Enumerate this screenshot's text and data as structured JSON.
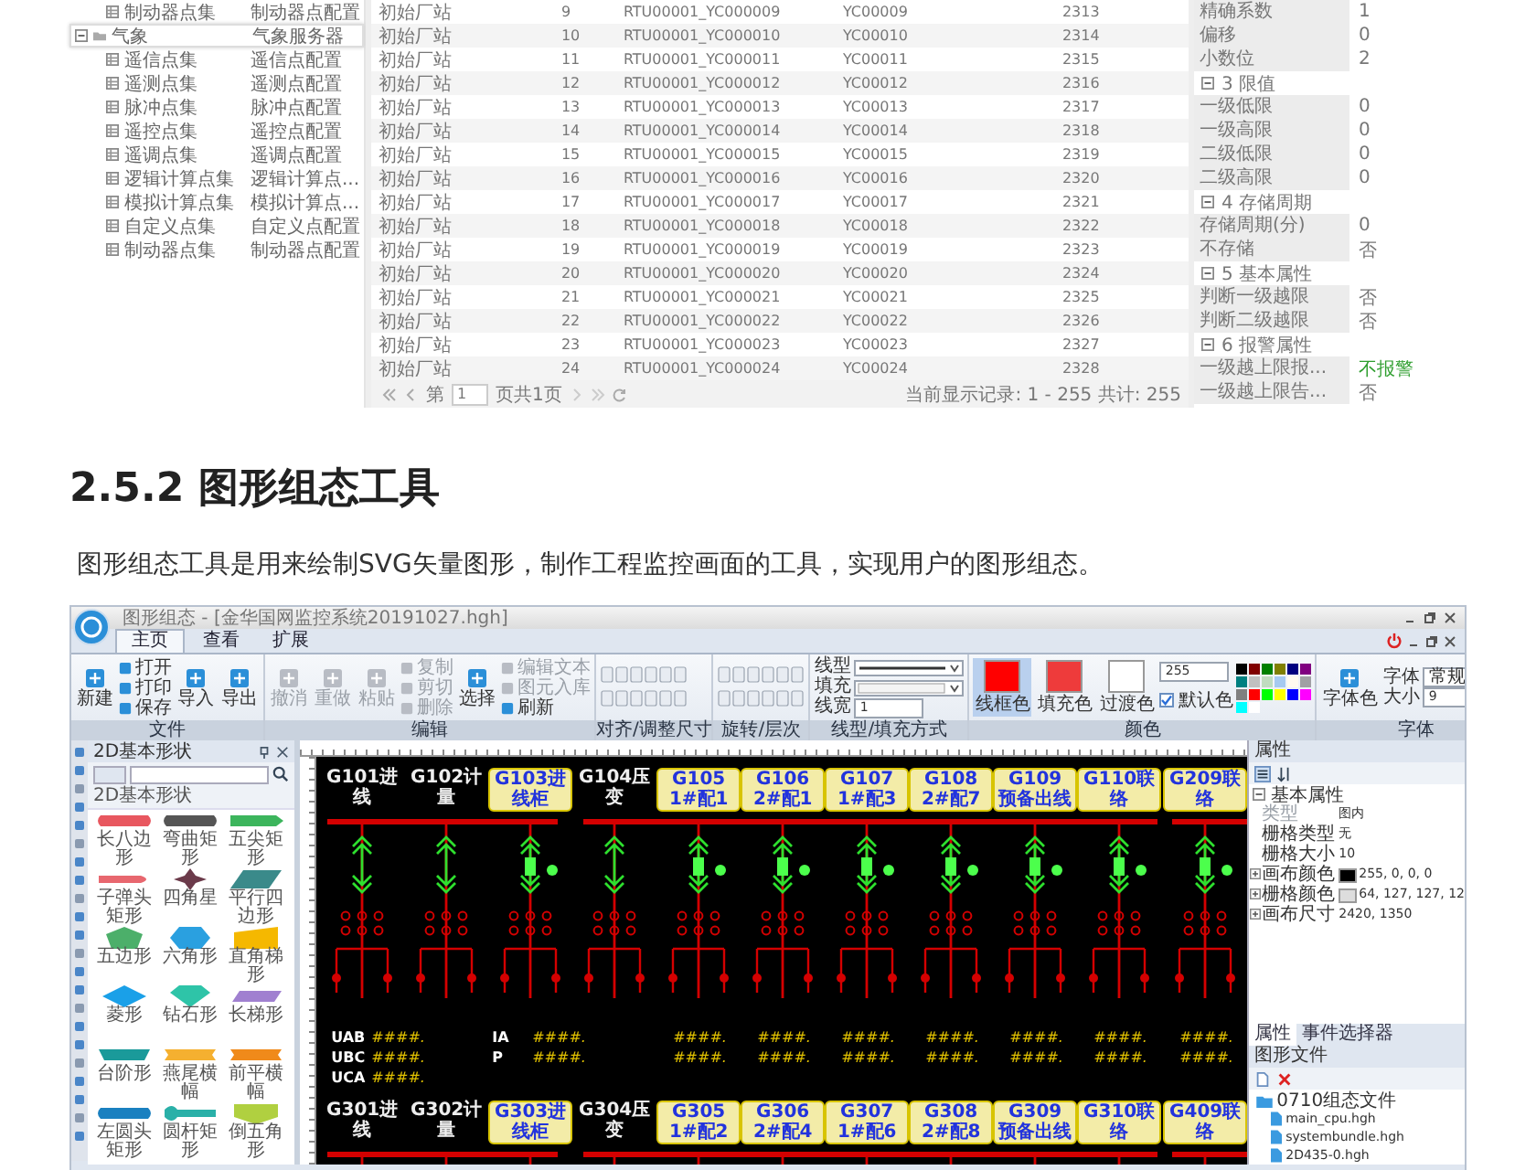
{
  "top_screenshot": {
    "tree": [
      {
        "label": "制动器点集",
        "config": "制动器点配置",
        "kind": "leaf",
        "selected": false
      },
      {
        "label": "气象",
        "config": "气象服务器",
        "kind": "folder",
        "selected": true
      },
      {
        "label": "遥信点集",
        "config": "遥信点配置",
        "kind": "leaf",
        "selected": false
      },
      {
        "label": "遥测点集",
        "config": "遥测点配置",
        "kind": "leaf",
        "selected": false
      },
      {
        "label": "脉冲点集",
        "config": "脉冲点配置",
        "kind": "leaf",
        "selected": false
      },
      {
        "label": "遥控点集",
        "config": "遥控点配置",
        "kind": "leaf",
        "selected": false
      },
      {
        "label": "遥调点集",
        "config": "遥调点配置",
        "kind": "leaf",
        "selected": false
      },
      {
        "label": "逻辑计算点集",
        "config": "逻辑计算点...",
        "kind": "leaf",
        "selected": false
      },
      {
        "label": "模拟计算点集",
        "config": "模拟计算点...",
        "kind": "leaf",
        "selected": false
      },
      {
        "label": "自定义点集",
        "config": "自定义点配置",
        "kind": "leaf",
        "selected": false
      },
      {
        "label": "制动器点集",
        "config": "制动器点配置",
        "kind": "leaf",
        "selected": false
      }
    ],
    "rows": [
      {
        "station": "初始厂站",
        "index": "9",
        "code": "RTU00001_YC000009",
        "name": "YC00009",
        "id": "2313"
      },
      {
        "station": "初始厂站",
        "index": "10",
        "code": "RTU00001_YC000010",
        "name": "YC00010",
        "id": "2314"
      },
      {
        "station": "初始厂站",
        "index": "11",
        "code": "RTU00001_YC000011",
        "name": "YC00011",
        "id": "2315"
      },
      {
        "station": "初始厂站",
        "index": "12",
        "code": "RTU00001_YC000012",
        "name": "YC00012",
        "id": "2316"
      },
      {
        "station": "初始厂站",
        "index": "13",
        "code": "RTU00001_YC000013",
        "name": "YC00013",
        "id": "2317"
      },
      {
        "station": "初始厂站",
        "index": "14",
        "code": "RTU00001_YC000014",
        "name": "YC00014",
        "id": "2318"
      },
      {
        "station": "初始厂站",
        "index": "15",
        "code": "RTU00001_YC000015",
        "name": "YC00015",
        "id": "2319"
      },
      {
        "station": "初始厂站",
        "index": "16",
        "code": "RTU00001_YC000016",
        "name": "YC00016",
        "id": "2320"
      },
      {
        "station": "初始厂站",
        "index": "17",
        "code": "RTU00001_YC000017",
        "name": "YC00017",
        "id": "2321"
      },
      {
        "station": "初始厂站",
        "index": "18",
        "code": "RTU00001_YC000018",
        "name": "YC00018",
        "id": "2322"
      },
      {
        "station": "初始厂站",
        "index": "19",
        "code": "RTU00001_YC000019",
        "name": "YC00019",
        "id": "2323"
      },
      {
        "station": "初始厂站",
        "index": "20",
        "code": "RTU00001_YC000020",
        "name": "YC00020",
        "id": "2324"
      },
      {
        "station": "初始厂站",
        "index": "21",
        "code": "RTU00001_YC000021",
        "name": "YC00021",
        "id": "2325"
      },
      {
        "station": "初始厂站",
        "index": "22",
        "code": "RTU00001_YC000022",
        "name": "YC00022",
        "id": "2326"
      },
      {
        "station": "初始厂站",
        "index": "23",
        "code": "RTU00001_YC000023",
        "name": "YC00023",
        "id": "2327"
      },
      {
        "station": "初始厂站",
        "index": "24",
        "code": "RTU00001_YC000024",
        "name": "YC00024",
        "id": "2328"
      }
    ],
    "pager": {
      "page_prefix": "第",
      "page": "1",
      "page_suffix": "页共1页",
      "records": "当前显示记录: 1 - 255 共计: 255"
    },
    "properties": [
      {
        "kind": "row",
        "name": "精确系数",
        "value": "1",
        "alert": false
      },
      {
        "kind": "row",
        "name": "偏移",
        "value": "0",
        "alert": false
      },
      {
        "kind": "row",
        "name": "小数位",
        "value": "2",
        "alert": false
      },
      {
        "kind": "group",
        "name": "3 限值"
      },
      {
        "kind": "row",
        "name": "一级低限",
        "value": "0",
        "alert": false
      },
      {
        "kind": "row",
        "name": "一级高限",
        "value": "0",
        "alert": false
      },
      {
        "kind": "row",
        "name": "二级低限",
        "value": "0",
        "alert": false
      },
      {
        "kind": "row",
        "name": "二级高限",
        "value": "0",
        "alert": false
      },
      {
        "kind": "group",
        "name": "4 存储周期"
      },
      {
        "kind": "row",
        "name": "存储周期(分)",
        "value": "0",
        "alert": false
      },
      {
        "kind": "row",
        "name": "不存储",
        "value": "否",
        "alert": false
      },
      {
        "kind": "group",
        "name": "5 基本属性"
      },
      {
        "kind": "row",
        "name": "判断一级越限",
        "value": "否",
        "alert": false
      },
      {
        "kind": "row",
        "name": "判断二级越限",
        "value": "否",
        "alert": false
      },
      {
        "kind": "group",
        "name": "6 报警属性"
      },
      {
        "kind": "row",
        "name": "一级越上限报...",
        "value": "不报警",
        "alert": true
      },
      {
        "kind": "row",
        "name": "一级越上限告...",
        "value": "否",
        "alert": false
      }
    ]
  },
  "heading": "2.5.2 图形组态工具",
  "paragraph": "图形组态工具是用来绘制SVG矢量图形，制作工程监控画面的工具，实现用户的图形组态。",
  "editor": {
    "title": "图形组态 - [金华国网监控系统20191027.hgh]",
    "tabs": [
      {
        "label": "主页",
        "selected": true
      },
      {
        "label": "查看",
        "selected": false
      },
      {
        "label": "扩展",
        "selected": false
      }
    ],
    "ribbon": [
      {
        "label": "文件",
        "columns": [
          {
            "kind": "large",
            "label": "新建",
            "disabled": false
          },
          {
            "kind": "stack",
            "items": [
              {
                "label": "打开",
                "disabled": false
              },
              {
                "label": "打印",
                "disabled": false
              },
              {
                "label": "保存",
                "disabled": false
              }
            ]
          },
          {
            "kind": "large",
            "label": "导入",
            "disabled": false
          },
          {
            "kind": "large",
            "label": "导出",
            "disabled": false
          }
        ]
      },
      {
        "label": "编辑",
        "columns": [
          {
            "kind": "large",
            "label": "撤消",
            "disabled": true
          },
          {
            "kind": "large",
            "label": "重做",
            "disabled": true
          },
          {
            "kind": "large",
            "label": "粘贴",
            "disabled": true
          },
          {
            "kind": "stack",
            "items": [
              {
                "label": "复制",
                "disabled": true
              },
              {
                "label": "剪切",
                "disabled": true
              },
              {
                "label": "删除",
                "disabled": true
              }
            ]
          },
          {
            "kind": "large",
            "label": "选择",
            "disabled": false
          },
          {
            "kind": "stack",
            "items": [
              {
                "label": "编辑文本",
                "disabled": true
              },
              {
                "label": "图元入库",
                "disabled": true
              },
              {
                "label": "刷新",
                "disabled": false
              }
            ]
          }
        ]
      },
      {
        "label": "对齐/调整尺寸",
        "columns": [
          {
            "kind": "icon_grid"
          }
        ]
      },
      {
        "label": "旋转/层次",
        "columns": [
          {
            "kind": "icon_grid"
          }
        ]
      },
      {
        "label": "线型/填充方式",
        "columns": [
          {
            "kind": "fields",
            "items": [
              {
                "kind": "line",
                "label": "线型"
              },
              {
                "kind": "fill",
                "label": "填充"
              },
              {
                "kind": "number",
                "label": "线宽",
                "value": "1"
              }
            ]
          }
        ]
      },
      {
        "label": "颜色",
        "columns": [
          {
            "kind": "swatch",
            "label": "线框色",
            "color": "#ff0000",
            "selected": true
          },
          {
            "kind": "swatch",
            "label": "填充色",
            "color": "#ee3b3b",
            "selected": false
          },
          {
            "kind": "swatch",
            "label": "过渡色",
            "color": "#ffffff",
            "selected": false
          },
          {
            "kind": "opacity",
            "value": "255",
            "checkbox": "默认色",
            "checked": true
          },
          {
            "kind": "palette",
            "colors": [
              {
                "color": "#000000"
              },
              {
                "color": "#800000"
              },
              {
                "color": "#008000"
              },
              {
                "color": "#808000"
              },
              {
                "color": "#000080"
              },
              {
                "color": "#800080"
              },
              {
                "color": "#008080"
              },
              {
                "color": "#c0c0c0"
              },
              {
                "color": "#c0dcc0"
              },
              {
                "color": "#a6caf0"
              },
              {
                "color": "#fffbf0"
              },
              {
                "color": "#a0a0a4"
              },
              {
                "color": "#808080"
              },
              {
                "color": "#ff0000"
              },
              {
                "color": "#00ff00"
              },
              {
                "color": "#ffff00"
              },
              {
                "color": "#0000ff"
              },
              {
                "color": "#ff00ff"
              },
              {
                "color": "#00ffff"
              },
              {
                "color": "#ffffff"
              }
            ]
          }
        ]
      },
      {
        "label": "字体",
        "columns": [
          {
            "kind": "large",
            "label": "字体色",
            "disabled": false
          },
          {
            "kind": "fields",
            "items": [
              {
                "kind": "select",
                "label": "字体",
                "value": "常规"
              },
              {
                "kind": "number",
                "label": "大小",
                "value": "9"
              }
            ]
          }
        ]
      }
    ],
    "shapes_panel": {
      "title": "2D基本形状",
      "category": "2D基本形状",
      "shapes": [
        {
          "label": "长八边形",
          "kind": "bar",
          "color": "#e8575f"
        },
        {
          "label": "弯曲矩形",
          "kind": "bar",
          "color": "#555555"
        },
        {
          "label": "五尖矩形",
          "kind": "point",
          "color": "#3cb55c"
        },
        {
          "label": "子弹头矩形",
          "kind": "bullet",
          "color": "#e8676f"
        },
        {
          "label": "四角星",
          "kind": "star4",
          "color": "#6b3a4a"
        },
        {
          "label": "平行四边形",
          "kind": "parallelogram",
          "color": "#3a8a8a"
        },
        {
          "label": "五边形",
          "kind": "pentagon",
          "color": "#4caf6a"
        },
        {
          "label": "六角形",
          "kind": "hexagon",
          "color": "#2aa0e0"
        },
        {
          "label": "直角梯形",
          "kind": "trapezoid",
          "color": "#f5b800"
        },
        {
          "label": "菱形",
          "kind": "rhombus",
          "color": "#1aa0e8"
        },
        {
          "label": "钻石形",
          "kind": "gem",
          "color": "#2ec4a8"
        },
        {
          "label": "长梯形",
          "kind": "slant",
          "color": "#a080d0"
        },
        {
          "label": "台阶形",
          "kind": "step",
          "color": "#1a9a9a"
        },
        {
          "label": "燕尾横幅",
          "kind": "banner",
          "color": "#f5b030"
        },
        {
          "label": "前平横幅",
          "kind": "banner",
          "color": "#f08a1a"
        },
        {
          "label": "左圆头矩形",
          "kind": "bar",
          "color": "#1a80c0"
        },
        {
          "label": "圆杆矩形",
          "kind": "lollipop",
          "color": "#2ab0a8"
        },
        {
          "label": "倒五角形",
          "kind": "shield",
          "color": "#b0d040"
        }
      ]
    },
    "diagram": {
      "rows": [
        {
          "labels": [
            {
              "text": "G101进线",
              "highlighted": false
            },
            {
              "text": "G102计量",
              "highlighted": false
            },
            {
              "text": "G103进线柜",
              "highlighted": true
            },
            {
              "text": "G104压变",
              "highlighted": false
            },
            {
              "text": "G105 1#配1",
              "highlighted": true
            },
            {
              "text": "G106 2#配1",
              "highlighted": true
            },
            {
              "text": "G107 1#配3",
              "highlighted": true
            },
            {
              "text": "G108 2#配7",
              "highlighted": true
            },
            {
              "text": "G109 预备出线",
              "highlighted": true
            },
            {
              "text": "G110联络",
              "highlighted": true
            },
            {
              "text": "G209联络",
              "highlighted": true
            }
          ]
        },
        {
          "labels": [
            {
              "text": "G301进线",
              "highlighted": false
            },
            {
              "text": "G302计量",
              "highlighted": false
            },
            {
              "text": "G303进线柜",
              "highlighted": true
            },
            {
              "text": "G304压变",
              "highlighted": false
            },
            {
              "text": "G305 1#配2",
              "highlighted": true
            },
            {
              "text": "G306 2#配4",
              "highlighted": true
            },
            {
              "text": "G307 1#配6",
              "highlighted": true
            },
            {
              "text": "G308 2#配8",
              "highlighted": true
            },
            {
              "text": "G309 预备出线",
              "highlighted": true
            },
            {
              "text": "G310联络",
              "highlighted": true
            },
            {
              "text": "G409联络",
              "highlighted": true
            }
          ]
        }
      ],
      "meters": [
        {
          "rows": [
            {
              "label": "UAB",
              "value": "####."
            },
            {
              "label": "UBC",
              "value": "####."
            },
            {
              "label": "UCA",
              "value": "####."
            }
          ]
        },
        {
          "rows": [
            {
              "label": "IA",
              "value": "####."
            },
            {
              "label": "P",
              "value": "####."
            }
          ]
        },
        {
          "rows": [
            {
              "value": "####."
            },
            {
              "value": "####."
            }
          ]
        },
        {
          "rows": [
            {
              "value": "####."
            },
            {
              "value": "####."
            }
          ]
        },
        {
          "rows": [
            {
              "value": "####."
            },
            {
              "value": "####."
            }
          ]
        },
        {
          "rows": [
            {
              "value": "####."
            },
            {
              "value": "####."
            }
          ]
        },
        {
          "rows": [
            {
              "value": "####."
            },
            {
              "value": "####."
            }
          ]
        },
        {
          "rows": [
            {
              "value": "####."
            },
            {
              "value": "####."
            }
          ]
        },
        {
          "rows": [
            {
              "value": "####."
            },
            {
              "value": "####."
            }
          ]
        }
      ]
    },
    "properties_panel": {
      "title": "属性",
      "group": "基本属性",
      "rows": [
        {
          "name": "类型",
          "value": "图内",
          "expandable": false,
          "disabled": true
        },
        {
          "name": "栅格类型",
          "value": "无",
          "expandable": false,
          "disabled": false
        },
        {
          "name": "栅格大小",
          "value": "10",
          "expandable": false,
          "disabled": false
        },
        {
          "name": "画布颜色",
          "value": "255, 0, 0, 0",
          "expandable": true,
          "disabled": false,
          "color": "#000000"
        },
        {
          "name": "栅格颜色",
          "value": "64, 127, 127, 12",
          "expandable": true,
          "disabled": false,
          "color": "#dddddd"
        },
        {
          "name": "画布尺寸",
          "value": "2420, 1350",
          "expandable": true,
          "disabled": false
        }
      ],
      "tabs": [
        {
          "label": "属性",
          "selected": true
        },
        {
          "label": "事件选择器",
          "selected": false
        }
      ]
    },
    "files_panel": {
      "title": "图形文件",
      "items": [
        {
          "kind": "folder",
          "label": "0710组态文件",
          "children": [
            {
              "kind": "file",
              "label": "main_cpu.hgh"
            },
            {
              "kind": "file",
              "label": "systembundle.hgh"
            },
            {
              "kind": "file",
              "label": "2D435-0.hgh"
            }
          ]
        }
      ]
    }
  }
}
